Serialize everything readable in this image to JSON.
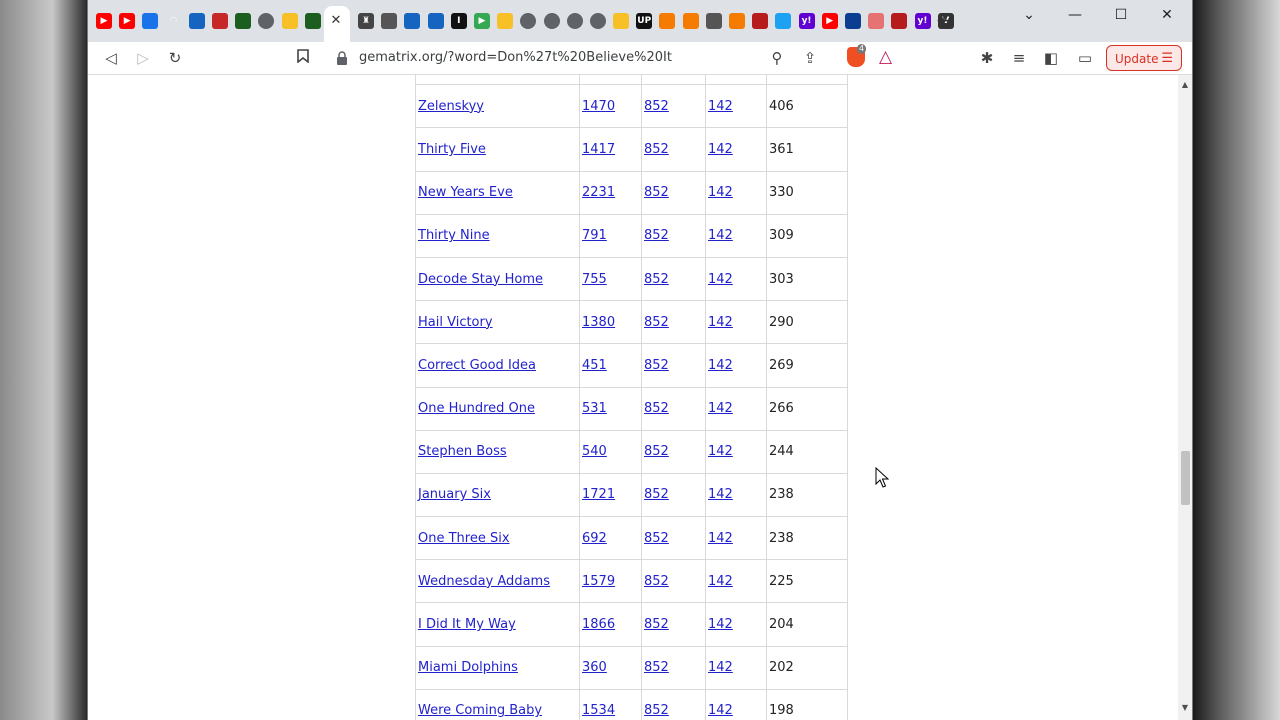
{
  "browser": {
    "url": "gematrix.org/?word=Don%27t%20Believe%20It",
    "brave_shields_count": "4",
    "update_label": "Update",
    "favicons": [
      {
        "name": "youtube-icon",
        "color": "#ff0000",
        "glyph": "▶"
      },
      {
        "name": "youtube-icon",
        "color": "#ff0000",
        "glyph": "▶"
      },
      {
        "name": "site-icon",
        "color": "#1a73e8",
        "glyph": ""
      },
      {
        "name": "loading-icon",
        "color": "#dee1e6",
        "glyph": "◠"
      },
      {
        "name": "yinyang-icon",
        "color": "#1565c0",
        "glyph": ""
      },
      {
        "name": "yinyang-icon",
        "color": "#c62828",
        "glyph": ""
      },
      {
        "name": "site-icon",
        "color": "#1b5e20",
        "glyph": ""
      },
      {
        "name": "globe-icon",
        "color": "#5f6368",
        "glyph": ""
      },
      {
        "name": "site-icon",
        "color": "#f6c026",
        "glyph": ""
      },
      {
        "name": "site-icon",
        "color": "#1b5e20",
        "glyph": ""
      }
    ],
    "favicons_right": [
      {
        "name": "site-icon",
        "color": "#444",
        "glyph": "♜"
      },
      {
        "name": "site-icon",
        "color": "#555",
        "glyph": ""
      },
      {
        "name": "site-icon",
        "color": "#1565c0",
        "glyph": ""
      },
      {
        "name": "site-icon",
        "color": "#1565c0",
        "glyph": ""
      },
      {
        "name": "site-icon",
        "color": "#111",
        "glyph": "I"
      },
      {
        "name": "play-icon",
        "color": "#34a853",
        "glyph": "▶"
      },
      {
        "name": "site-icon",
        "color": "#f6c026",
        "glyph": ""
      },
      {
        "name": "globe-icon",
        "color": "#5f6368",
        "glyph": ""
      },
      {
        "name": "globe-icon",
        "color": "#5f6368",
        "glyph": ""
      },
      {
        "name": "globe-icon",
        "color": "#5f6368",
        "glyph": ""
      },
      {
        "name": "globe-icon",
        "color": "#5f6368",
        "glyph": ""
      },
      {
        "name": "site-icon",
        "color": "#f6c026",
        "glyph": ""
      },
      {
        "name": "up-icon",
        "color": "#111",
        "glyph": "UP"
      },
      {
        "name": "site-icon",
        "color": "#f57c00",
        "glyph": ""
      },
      {
        "name": "site-icon",
        "color": "#f57c00",
        "glyph": ""
      },
      {
        "name": "site-icon",
        "color": "#555",
        "glyph": ""
      },
      {
        "name": "site-icon",
        "color": "#f57c00",
        "glyph": ""
      },
      {
        "name": "site-icon",
        "color": "#b71c1c",
        "glyph": ""
      },
      {
        "name": "twitter-icon",
        "color": "#1da1f2",
        "glyph": ""
      },
      {
        "name": "yahoo-icon",
        "color": "#6001d2",
        "glyph": "y!"
      },
      {
        "name": "youtube-icon",
        "color": "#ff0000",
        "glyph": "▶"
      },
      {
        "name": "site-icon",
        "color": "#0b3d91",
        "glyph": ""
      },
      {
        "name": "site-icon",
        "color": "#e57373",
        "glyph": ""
      },
      {
        "name": "site-icon",
        "color": "#b71c1c",
        "glyph": ""
      },
      {
        "name": "yahoo-icon",
        "color": "#6001d2",
        "glyph": "y!"
      },
      {
        "name": "site-icon",
        "color": "#333",
        "glyph": "V"
      }
    ]
  },
  "table": {
    "rows": [
      {
        "word": "Zelenskyy",
        "english": "1470",
        "simple": "852",
        "jewish": "142",
        "searches": "406"
      },
      {
        "word": "Thirty Five",
        "english": "1417",
        "simple": "852",
        "jewish": "142",
        "searches": "361"
      },
      {
        "word": "New Years Eve",
        "english": "2231",
        "simple": "852",
        "jewish": "142",
        "searches": "330"
      },
      {
        "word": "Thirty Nine",
        "english": "791",
        "simple": "852",
        "jewish": "142",
        "searches": "309"
      },
      {
        "word": "Decode Stay Home",
        "english": "755",
        "simple": "852",
        "jewish": "142",
        "searches": "303"
      },
      {
        "word": "Hail Victory",
        "english": "1380",
        "simple": "852",
        "jewish": "142",
        "searches": "290"
      },
      {
        "word": "Correct Good Idea",
        "english": "451",
        "simple": "852",
        "jewish": "142",
        "searches": "269"
      },
      {
        "word": "One Hundred One",
        "english": "531",
        "simple": "852",
        "jewish": "142",
        "searches": "266"
      },
      {
        "word": "Stephen Boss",
        "english": "540",
        "simple": "852",
        "jewish": "142",
        "searches": "244"
      },
      {
        "word": "January Six",
        "english": "1721",
        "simple": "852",
        "jewish": "142",
        "searches": "238"
      },
      {
        "word": "One Three Six",
        "english": "692",
        "simple": "852",
        "jewish": "142",
        "searches": "238"
      },
      {
        "word": "Wednesday Addams",
        "english": "1579",
        "simple": "852",
        "jewish": "142",
        "searches": "225"
      },
      {
        "word": "I Did It My Way",
        "english": "1866",
        "simple": "852",
        "jewish": "142",
        "searches": "204"
      },
      {
        "word": "Miami Dolphins",
        "english": "360",
        "simple": "852",
        "jewish": "142",
        "searches": "202"
      },
      {
        "word": "Were Coming Baby",
        "english": "1534",
        "simple": "852",
        "jewish": "142",
        "searches": "198"
      }
    ]
  }
}
